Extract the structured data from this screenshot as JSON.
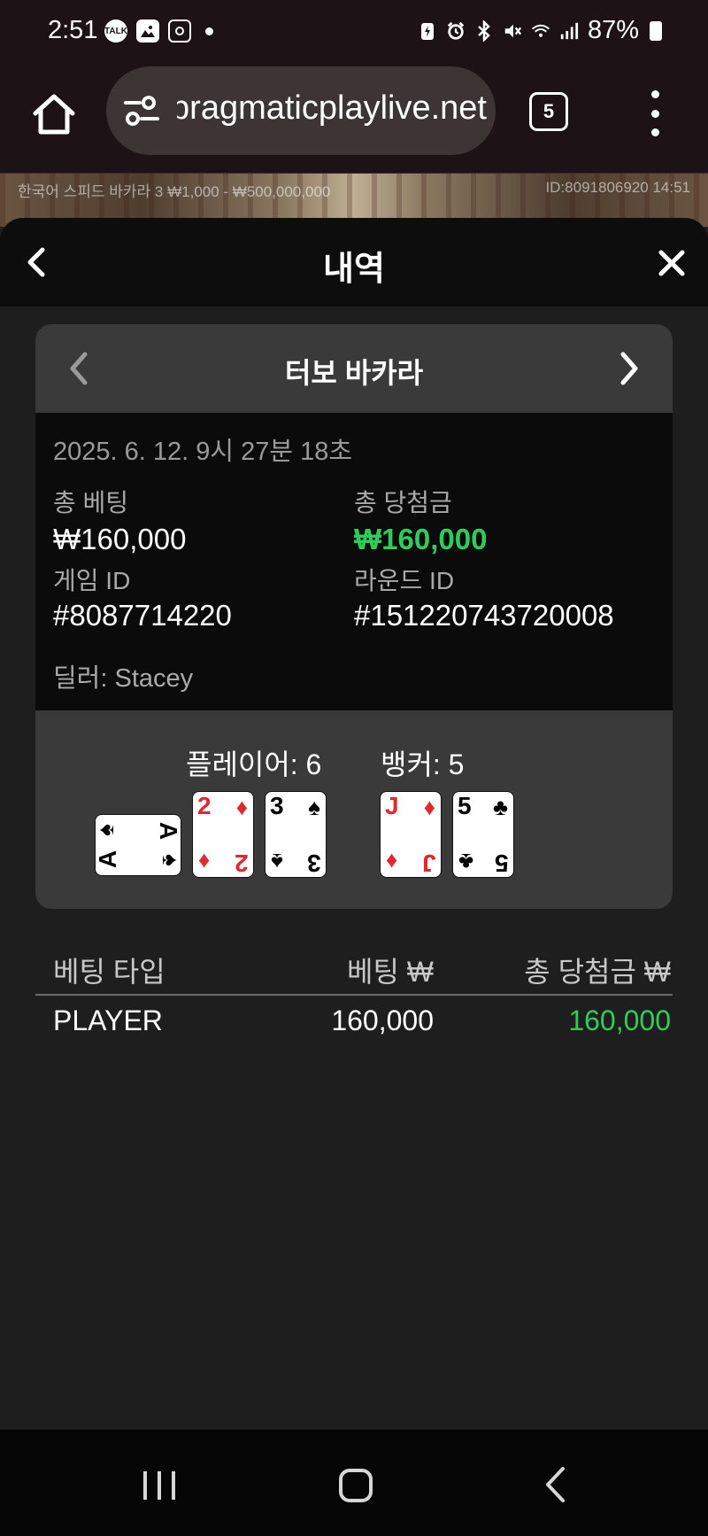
{
  "status_bar": {
    "time": "2:51",
    "left_icons": [
      "talk-icon",
      "gallery-icon",
      "instagram-icon",
      "dot-icon"
    ],
    "right_icons": [
      "battery-saver-icon",
      "alarm-icon",
      "bluetooth-icon",
      "mute-icon",
      "wifi-icon",
      "signal-icon",
      "battery-icon"
    ],
    "battery_percent": "87%"
  },
  "browser": {
    "url": "pragmaticplaylive.net",
    "tab_count": "5"
  },
  "game_strip": {
    "left_text": "한국어 스피드 바카라 3   ₩1,000 - ₩500,000,000",
    "right_text": "ID:8091806920   14:51"
  },
  "modal": {
    "title": "내역",
    "card": {
      "game_name": "터보 바카라",
      "datetime": "2025. 6. 12. 9시 27분 18초",
      "total_bet_label": "총 베팅",
      "total_bet_value": "₩160,000",
      "total_win_label": "총 당첨금",
      "total_win_value": "₩160,000",
      "game_id_label": "게임 ID",
      "game_id_value": "#8087714220",
      "round_id_label": "라운드 ID",
      "round_id_value": "#151220743720008",
      "dealer": "딜러: Stacey",
      "player_score": "플레이어: 6",
      "banker_score": "뱅커: 5",
      "player_cards": [
        {
          "rank": "A",
          "suit": "♠",
          "color": "#000000",
          "orientation": "sideways"
        },
        {
          "rank": "2",
          "suit": "♦",
          "color": "#e0282e",
          "orientation": "upright"
        },
        {
          "rank": "3",
          "suit": "♠",
          "color": "#000000",
          "orientation": "upright"
        }
      ],
      "banker_cards": [
        {
          "rank": "J",
          "suit": "♦",
          "color": "#e0282e",
          "orientation": "upright"
        },
        {
          "rank": "5",
          "suit": "♣",
          "color": "#000000",
          "orientation": "upright"
        }
      ]
    },
    "bets_table": {
      "headers": [
        "베팅 타입",
        "베팅 ₩",
        "총 당첨금 ₩"
      ],
      "rows": [
        {
          "type": "PLAYER",
          "bet": "160,000",
          "win": "160,000"
        }
      ]
    }
  },
  "colors": {
    "accent_green": "#2ecc5a",
    "card_red": "#e0282e",
    "panel_grey": "#3a3a3a",
    "background": "#1e1e1e"
  }
}
